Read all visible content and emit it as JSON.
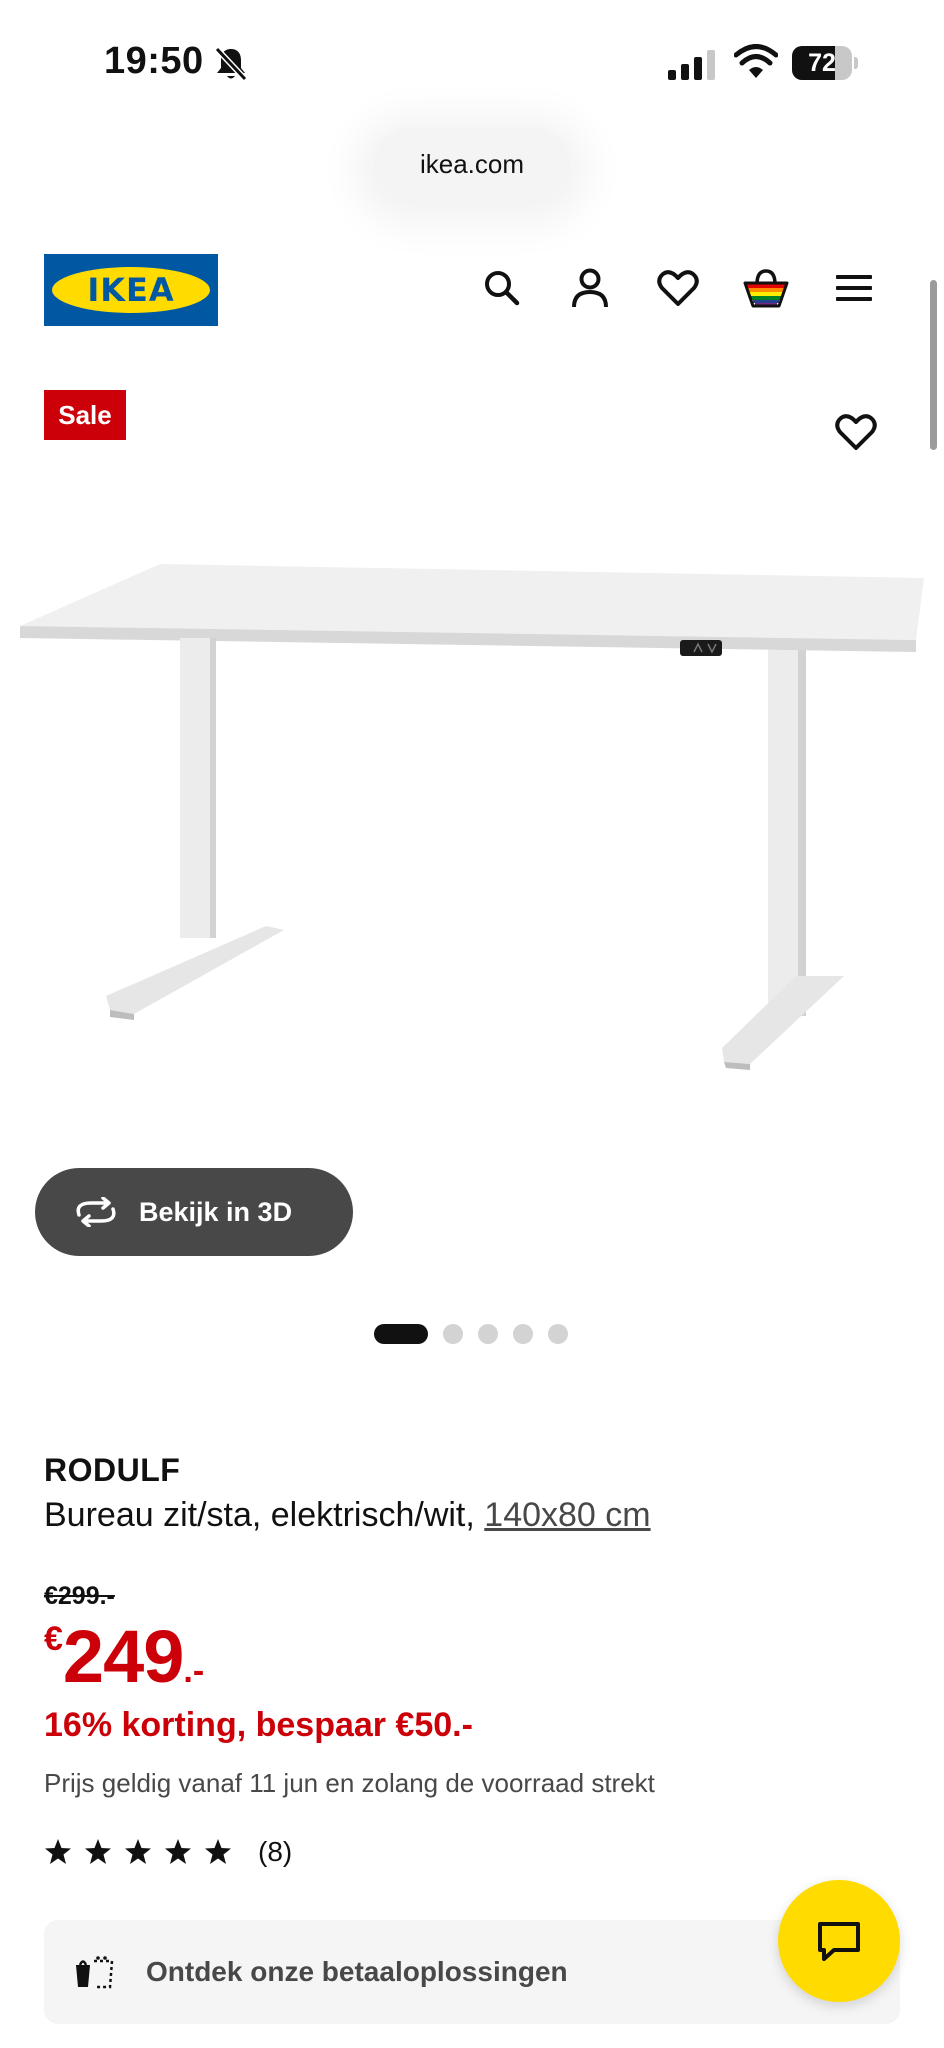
{
  "status_bar": {
    "time": "19:50",
    "battery": "72",
    "battery_level": 0.72
  },
  "browser": {
    "url": "ikea.com"
  },
  "header": {
    "logo_text": "IKEA",
    "brand_colors": {
      "blue": "#0058a3",
      "yellow": "#ffdb00"
    },
    "icons": [
      "search-icon",
      "user-icon",
      "heart-icon",
      "cart-icon",
      "menu-icon"
    ]
  },
  "gallery": {
    "sale_badge": "Sale",
    "view_3d_label": "Bekijk in 3D",
    "slide_count": 5,
    "active_slide": 1
  },
  "product": {
    "name": "RODULF",
    "description": "Bureau zit/sta, elektrisch/wit,",
    "size": "140x80 cm",
    "old_price": "€299.-",
    "price_currency": "€",
    "price_amount": "249",
    "price_suffix": ".-",
    "discount": "16% korting, bespaar €50.-",
    "validity": "Prijs geldig vanaf 11 jun en zolang de voorraad strekt",
    "rating_stars": 5,
    "rating_count": "(8)",
    "sale_color": "#cc0008"
  },
  "payment_banner": {
    "label": "Ontdek onze betaaloplossingen"
  },
  "chat": {
    "icon": "chat-icon"
  }
}
